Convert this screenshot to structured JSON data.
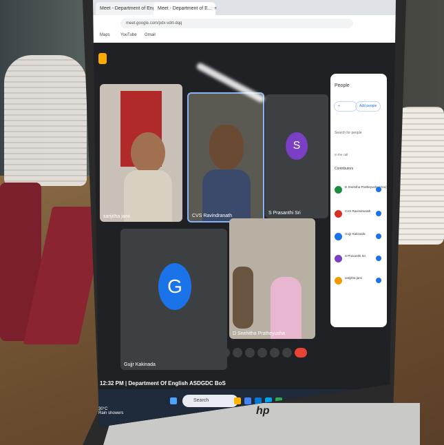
{
  "browser": {
    "tabs": [
      "Meet - Department of English",
      "Meet - Department of E...",
      "+"
    ],
    "url": "meet.google.com/pdx-vdrt-dqq",
    "bookmarks": [
      "Maps",
      "YouTube",
      "Gmail"
    ]
  },
  "meeting": {
    "participants": [
      {
        "label": "sarijitha jami",
        "type": "video"
      },
      {
        "label": "CVS Ravindranath",
        "type": "video",
        "active": true
      },
      {
        "label": "S Prasanthi Sri",
        "type": "avatar",
        "initial": "S",
        "color": "#7b3fc6"
      },
      {
        "label": "Gujjr Kakinada",
        "type": "avatar",
        "initial": "G",
        "color": "#1a73e8"
      },
      {
        "label": "D Snehitha Pratheyusha",
        "type": "video"
      }
    ],
    "footer": "12:32 PM | Department Of English ASDGDC BoS"
  },
  "people_panel": {
    "title": "People",
    "add_label": "Add people",
    "search_placeholder": "Search for people",
    "in_call": "In the call",
    "contributors": "Contributors",
    "list": [
      {
        "name": "D Snehitha Pratheyusha (You)",
        "color": "#1e8e3e"
      },
      {
        "name": "CVS Ravindranath",
        "color": "#d93025"
      },
      {
        "name": "Gujjr Kakinada",
        "color": "#1a73e8"
      },
      {
        "name": "S Prasanthi Sri",
        "color": "#7b3fc6"
      },
      {
        "name": "sarijitha jami",
        "color": "#f29900"
      }
    ]
  },
  "taskbar": {
    "search_label": "Search",
    "weather_temp": "30°C",
    "weather_desc": "Rain showers"
  },
  "laptop_brand": "hp"
}
